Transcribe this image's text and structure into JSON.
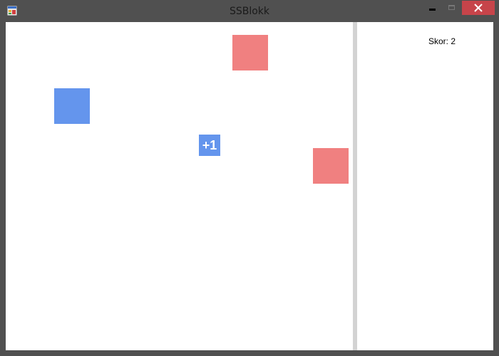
{
  "window": {
    "title": "SSBlokk",
    "icon": "app-icon",
    "controls": {
      "minimize_icon": "minimize-icon",
      "maximize_icon": "maximize-icon",
      "close_icon": "close-icon"
    }
  },
  "side_panel": {
    "score_label": "Skor: 2"
  },
  "game": {
    "bonus_text": "+1",
    "colors": {
      "red_block": "#f08080",
      "blue_block": "#6495ed",
      "divider": "#d3d3d3"
    }
  }
}
